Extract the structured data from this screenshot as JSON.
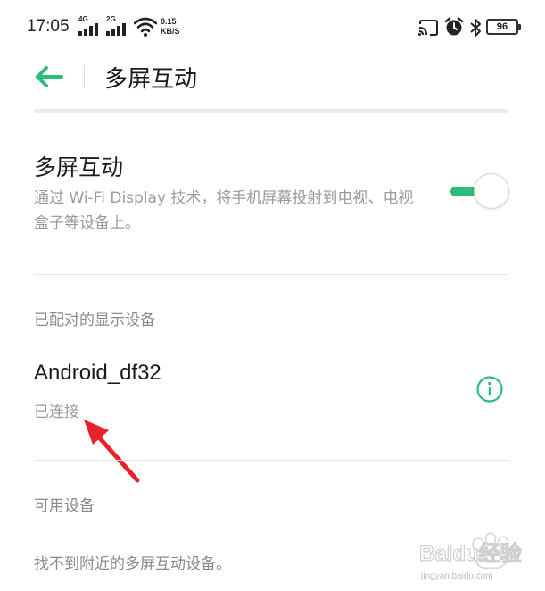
{
  "status_bar": {
    "time": "17:05",
    "sim1_label": "4G",
    "sim2_label": "2G",
    "speed_value": "0.15",
    "speed_unit": "KB/S",
    "battery": "96"
  },
  "header": {
    "title": "多屏互动"
  },
  "screen_mirror": {
    "title": "多屏互动",
    "description": "通过 Wi-Fi Display 技术，将手机屏幕投射到电视、电视盒子等设备上。",
    "enabled": true
  },
  "paired_devices": {
    "label": "已配对的显示设备",
    "devices": [
      {
        "name": "Android_df32",
        "status": "已连接"
      }
    ]
  },
  "available_devices": {
    "label": "可用设备",
    "empty_message": "找不到附近的多屏互动设备。"
  },
  "watermark": {
    "text": "Baidu经验",
    "subtext": "jingyan.baidu.com"
  },
  "colors": {
    "accent": "#2ebc7c",
    "arrow": "#e8222b"
  }
}
